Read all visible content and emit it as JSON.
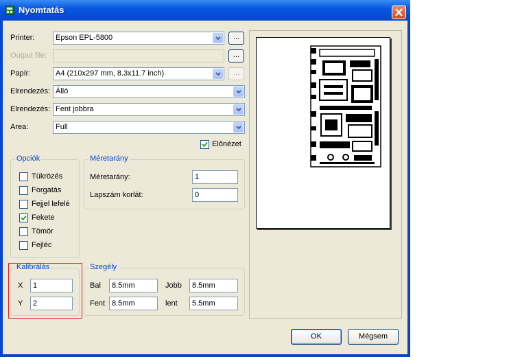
{
  "window": {
    "title": "Nyomtatás"
  },
  "form": {
    "printer": {
      "label": "Printer:",
      "value": "Epson EPL-5800",
      "browse": "..."
    },
    "output_file": {
      "label": "Output file:",
      "value": "",
      "browse": "..."
    },
    "paper": {
      "label": "Papír:",
      "value": "A4 (210x297 mm, 8.3x11.7 inch)",
      "browse": "..."
    },
    "orientation": {
      "label": "Elrendezés:",
      "value": "Álló"
    },
    "layout": {
      "label": "Elrendezés:",
      "value": "Fent jobbra"
    },
    "area": {
      "label": "Area:",
      "value": "Full"
    },
    "preview_check": {
      "label": "Előnézet",
      "checked": true
    }
  },
  "options": {
    "legend": "Opciók",
    "items": [
      {
        "label": "Tükrözés",
        "checked": false
      },
      {
        "label": "Forgatás",
        "checked": false
      },
      {
        "label": "Fejjel lefelé",
        "checked": false
      },
      {
        "label": "Fekete",
        "checked": true
      },
      {
        "label": "Tömör",
        "checked": false
      },
      {
        "label": "Fejléc",
        "checked": false
      }
    ]
  },
  "scale": {
    "legend": "Méretarány",
    "ratio_label": "Méretarány:",
    "ratio_value": "1",
    "limit_label": "Lapszám korlát:",
    "limit_value": "0"
  },
  "calibration": {
    "legend": "Kalibrálás",
    "x_label": "X",
    "x_value": "1",
    "y_label": "Y",
    "y_value": "2"
  },
  "margins": {
    "legend": "Szegély",
    "left_label": "Bal",
    "left_value": "8.5mm",
    "right_label": "Jobb",
    "right_value": "8.5mm",
    "top_label": "Fent",
    "top_value": "8.5mm",
    "bottom_label": "lent",
    "bottom_value": "5.5mm"
  },
  "buttons": {
    "ok": "OK",
    "cancel": "Mégsem"
  },
  "icons": {
    "app": "printer-board-icon",
    "close": "close-icon",
    "dropdown": "chevron-down-icon",
    "check": "checkmark-icon"
  },
  "colors": {
    "titlebar": "#0a58e0",
    "group_legend": "#0046d5",
    "highlight_box": "#d42020",
    "close_button": "#d04a22"
  }
}
